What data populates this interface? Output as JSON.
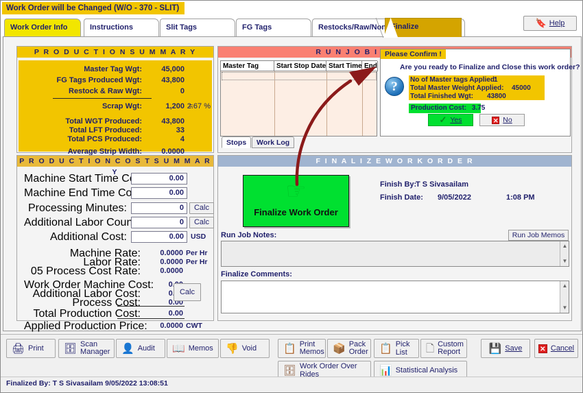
{
  "window": {
    "banner": "Work Order will be Changed  (W/O - 370 - SLIT)"
  },
  "tabs": [
    {
      "label": "Work Order Info",
      "state": "yellow"
    },
    {
      "label": "Instructions",
      "state": "normal"
    },
    {
      "label": "Slit Tags",
      "state": "normal"
    },
    {
      "label": "FG Tags",
      "state": "normal"
    },
    {
      "label": "Restocks/Raw/Non FG",
      "state": "normal"
    },
    {
      "label": "Finalize",
      "state": "active"
    }
  ],
  "help": {
    "label": "Help"
  },
  "production_summary": {
    "title": "P R O D U C T I O N     S U M M A R Y",
    "rows": [
      {
        "label": "Master Tag Wgt:",
        "value": "45,000"
      },
      {
        "label": "FG Tags Produced Wgt:",
        "value": "43,800"
      },
      {
        "label": "Restock & Raw Wgt:",
        "value": "0"
      },
      {
        "label": "Scrap Wgt:",
        "value": "1,200",
        "eq": "=",
        "pct": "2.67  %"
      },
      {
        "label": "Total WGT Produced:",
        "value": "43,800"
      },
      {
        "label": "Total LFT Produced:",
        "value": "33"
      },
      {
        "label": "Total PCS Produced:",
        "value": "4"
      },
      {
        "label": "Average Strip Width:",
        "value": "0.0000"
      }
    ]
  },
  "cost_summary": {
    "title": "P R O D U C T I O N   C O S T  S U M M A R Y",
    "fields": [
      {
        "label": "Machine Start Time Counter:",
        "value": "0.00"
      },
      {
        "label": "Machine End Time Counter:",
        "value": "0.00"
      },
      {
        "label": "Processing Minutes:",
        "value": "0",
        "button": "Calc"
      },
      {
        "label": "Additional Labor Count:",
        "value": "0",
        "button": "Calc"
      },
      {
        "label": "Additional Cost:",
        "value": "0.00",
        "unit": "USD"
      }
    ],
    "rates": [
      {
        "label": "Machine Rate:",
        "value": "0.0000",
        "unit": "Per Hr"
      },
      {
        "label": "Labor Rate:",
        "value": "0.0000",
        "unit": "Per Hr"
      },
      {
        "label": "05 Process Cost Rate:",
        "value": "0.0000",
        "unit": ""
      }
    ],
    "costs": [
      {
        "label": "Work Order Machine Cost:",
        "value": "0.00"
      },
      {
        "label": "Additional Labor Cost:",
        "value": "0.00"
      },
      {
        "label": "Process Cost:",
        "value": "0.00"
      },
      {
        "label": "Total Production Cost:",
        "value": "0.00"
      },
      {
        "label": "Applied Production Price:",
        "value": "0.0000",
        "unit": "CWT"
      }
    ],
    "calc_button": "Calc"
  },
  "run_job": {
    "title": "R U N   J O B   I N F O R M A T I O N",
    "columns": [
      "Master Tag",
      "Start Stop Date",
      "Start Time",
      "End"
    ],
    "rows": [],
    "sub_tabs": [
      {
        "label": "Stops",
        "selected": true
      },
      {
        "label": "Work Log",
        "selected": false
      }
    ]
  },
  "confirm_dialog": {
    "title": "Please Confirm !",
    "question": "Are you ready to Finalize and Close this work order?",
    "icon": "question-mark-icon",
    "info": [
      {
        "label": "No of Master tags Applied:",
        "value": "1"
      },
      {
        "label": "Total Master Weight Applied:",
        "value": "45000"
      },
      {
        "label": "Total Finished Wgt:",
        "value": "43800"
      }
    ],
    "production_cost_label": "Production Cost:",
    "production_cost_value": "3.75",
    "yes_label": "Yes",
    "no_label": "No"
  },
  "finalize": {
    "title": "F I N A L I Z E    W O R K O R D E R",
    "button_label": "Finalize Work Order",
    "finish_by_label": "Finish By:",
    "finish_by_value": "T S Sivasailam",
    "finish_date_label": "Finish Date:",
    "finish_date_value": "9/05/2022",
    "finish_time_value": "1:08 PM",
    "run_job_notes_label": "Run Job Notes:",
    "run_job_notes_value": "",
    "run_job_memos_button": "Run Job Memos",
    "finalize_comments_label": "Finalize Comments:",
    "finalize_comments_value": ""
  },
  "toolbar": {
    "row1": [
      {
        "label": "Print",
        "icon": "printer-icon"
      },
      {
        "label": "Scan",
        "label2": "Manager",
        "icon": "scanner-icon"
      },
      {
        "label": "Audit",
        "icon": "person-icon"
      },
      {
        "label": "Memos",
        "icon": "book-icon"
      },
      {
        "label": "Void",
        "icon": "thumbs-down-icon"
      },
      {
        "label": "Print",
        "label2": "Memos",
        "icon": "print-memos-icon"
      },
      {
        "label": "Pack",
        "label2": "Order",
        "icon": "box-icon"
      },
      {
        "label": "Pick List",
        "icon": "list-icon"
      },
      {
        "label": "Custom",
        "label2": "Report",
        "icon": "report-icon"
      },
      {
        "label": "Save",
        "icon": "save-icon"
      },
      {
        "label": "Cancel",
        "icon": "cancel-icon"
      }
    ],
    "row2": [
      {
        "label": "Work Order Over Rides",
        "icon": "overrides-icon"
      },
      {
        "label": "Statistical Analysis",
        "icon": "chart-icon"
      }
    ]
  },
  "status": {
    "text": "Finalized By: T S Sivasailam  9/05/2022 13:08:51"
  },
  "colors": {
    "gold": "#f2c500",
    "active_tab": "#d4a400",
    "salmon": "#fa8072",
    "green": "#00e030",
    "steel_blue": "#a0b4d0",
    "navy_text": "#1f1f6b",
    "arrow_red": "#8b1a1a"
  }
}
